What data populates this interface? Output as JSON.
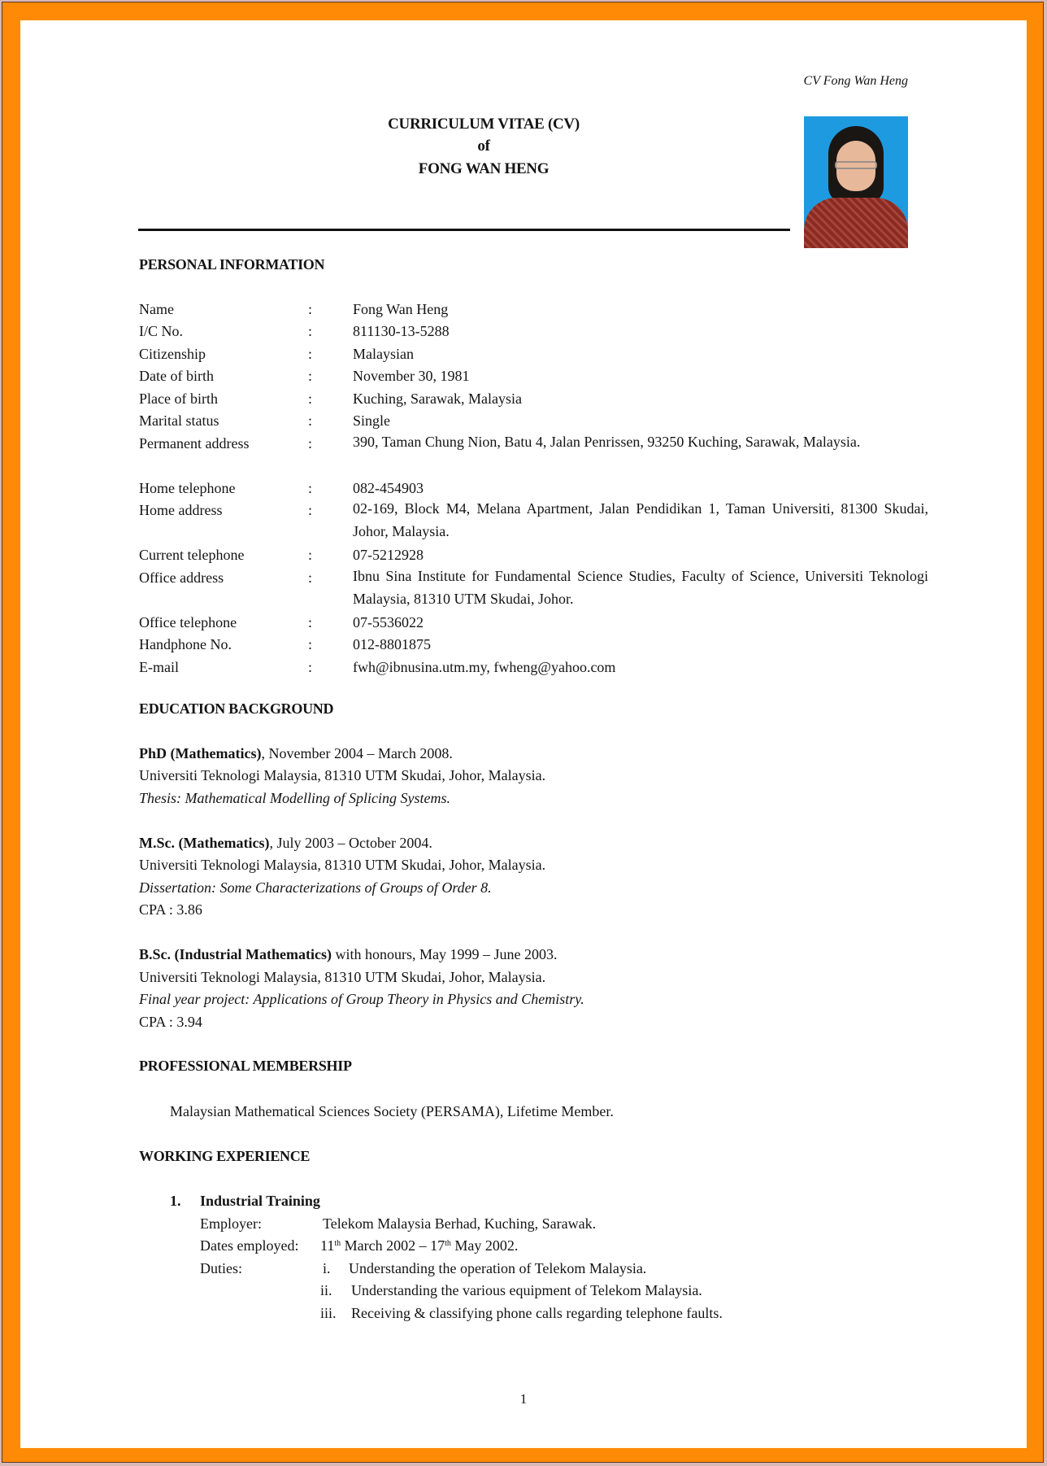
{
  "running_header": "CV Fong Wan Heng",
  "title": {
    "line1": "CURRICULUM VITAE (CV)",
    "line2": "of",
    "line3": "FONG WAN HENG"
  },
  "photo": {
    "alt": "Portrait photo of Fong Wan Heng"
  },
  "personal_information": {
    "heading": "PERSONAL INFORMATION",
    "separator": ":",
    "rows": [
      {
        "label": "Name",
        "value": "Fong Wan Heng"
      },
      {
        "label": "I/C No.",
        "value": "811130-13-5288"
      },
      {
        "label": "Citizenship",
        "value": "Malaysian"
      },
      {
        "label": "Date of birth",
        "value": "November 30, 1981"
      },
      {
        "label": "Place of birth",
        "value": "Kuching, Sarawak, Malaysia"
      },
      {
        "label": "Marital status",
        "value": "Single"
      },
      {
        "label": "Permanent address",
        "value": "390, Taman Chung Nion, Batu 4, Jalan Penrissen, 93250 Kuching, Sarawak, Malaysia."
      },
      {
        "label": "Home telephone",
        "value": "082-454903"
      },
      {
        "label": "Home address",
        "value": "02-169, Block M4, Melana Apartment, Jalan Pendidikan 1, Taman Universiti, 81300 Skudai, Johor, Malaysia."
      },
      {
        "label": "Current telephone",
        "value": "07-5212928"
      },
      {
        "label": "Office address",
        "value": "Ibnu Sina Institute for Fundamental Science Studies, Faculty of Science, Universiti Teknologi Malaysia, 81310 UTM Skudai, Johor."
      },
      {
        "label": "Office telephone",
        "value": "07-5536022"
      },
      {
        "label": "Handphone No.",
        "value": "012-8801875"
      },
      {
        "label": "E-mail",
        "value": "fwh@ibnusina.utm.my, fwheng@yahoo.com"
      }
    ]
  },
  "education": {
    "heading": "EDUCATION BACKGROUND",
    "entries": [
      {
        "degree": "PhD (Mathematics)",
        "degree_suffix": ", November 2004 – March 2008.",
        "institution": "Universiti Teknologi Malaysia, 81310 UTM Skudai, Johor, Malaysia.",
        "note": "Thesis: Mathematical Modelling of Splicing Systems.",
        "cpa": ""
      },
      {
        "degree": "M.Sc. (Mathematics)",
        "degree_suffix": ", July 2003 – October 2004.",
        "institution": "Universiti Teknologi Malaysia, 81310 UTM Skudai, Johor, Malaysia.",
        "note": "Dissertation: Some Characterizations of Groups of Order 8.",
        "cpa": "CPA : 3.86"
      },
      {
        "degree": "B.Sc. (Industrial Mathematics)",
        "degree_suffix": " with honours, May 1999 – June 2003.",
        "institution": "Universiti Teknologi Malaysia, 81310 UTM Skudai, Johor, Malaysia.",
        "note": "Final year project: Applications of Group Theory in Physics and Chemistry.",
        "cpa": "CPA : 3.94"
      }
    ]
  },
  "membership": {
    "heading": "PROFESSIONAL MEMBERSHIP",
    "text": "Malaysian Mathematical Sciences Society (PERSAMA), Lifetime Member."
  },
  "experience": {
    "heading": "WORKING EXPERIENCE",
    "jobs": [
      {
        "number": "1.",
        "title": "Industrial Training",
        "employer_label": "Employer:",
        "employer": "Telekom Malaysia Berhad, Kuching, Sarawak.",
        "dates_label": "Dates employed:",
        "start_day": "11",
        "start_suffix": "th",
        "start_rest": " March 2002 – ",
        "end_day": "17",
        "end_suffix": "th",
        "end_rest": " May 2002.",
        "duties_label": "Duties:",
        "duties": [
          {
            "marker": "i.",
            "text": "Understanding the operation of Telekom Malaysia."
          },
          {
            "marker": "ii.",
            "text": "Understanding the various equipment of Telekom Malaysia."
          },
          {
            "marker": "iii.",
            "text": "Receiving & classifying phone calls regarding telephone faults."
          }
        ]
      }
    ]
  },
  "page_number": "1",
  "colors": {
    "frame": "#ff8a05",
    "page": "#ffffff",
    "text": "#141414"
  }
}
